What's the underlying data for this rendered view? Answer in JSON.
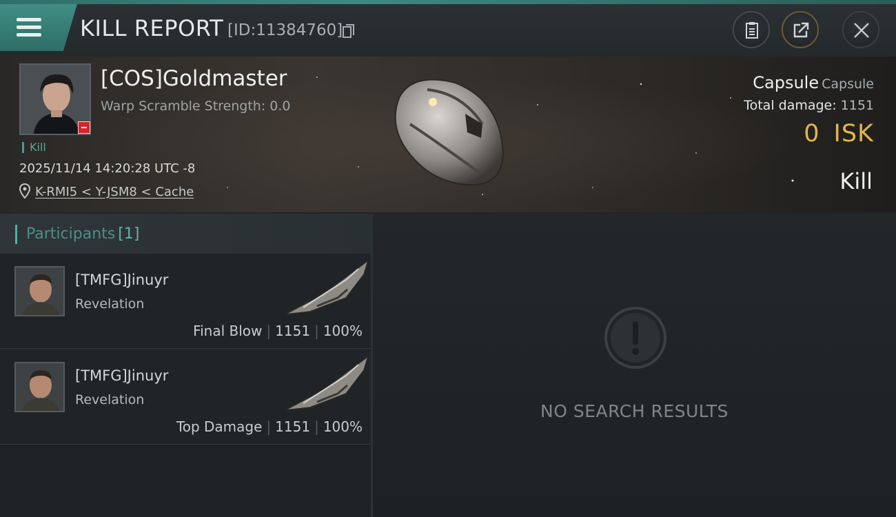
{
  "header": {
    "title": "KILL REPORT",
    "report_id": "[ID:11384760]"
  },
  "victim": {
    "name": "[COS]Goldmaster",
    "warp_scramble": "Warp Scramble Strength: 0.0",
    "kill_tag": "Kill",
    "timestamp": "2025/11/14 14:20:28 UTC -8",
    "location": "K-RMI5 < Y-JSM8 < Cache",
    "ship_name": "Capsule",
    "ship_class": "Capsule",
    "damage_label": "Total damage:",
    "damage_value": "1151",
    "isk_value": "0",
    "isk_unit": "ISK",
    "result": "Kill"
  },
  "participants": {
    "label": "Participants",
    "count": "[1]",
    "rows": [
      {
        "name": "[TMFG]Jinuyr",
        "ship": "Revelation",
        "role": "Final Blow",
        "damage": "1151",
        "percent": "100%"
      },
      {
        "name": "[TMFG]Jinuyr",
        "ship": "Revelation",
        "role": "Top Damage",
        "damage": "1151",
        "percent": "100%"
      }
    ]
  },
  "right_panel": {
    "empty_text": "NO SEARCH RESULTS"
  },
  "colors": {
    "accent_teal": "#4ab3a6",
    "isk_gold": "#e2b64b",
    "badge_red": "#d3262b"
  },
  "icons": [
    "menu-icon",
    "copy-icon",
    "report-icon",
    "share-icon",
    "close-icon",
    "location-pin-icon",
    "alert-icon"
  ]
}
